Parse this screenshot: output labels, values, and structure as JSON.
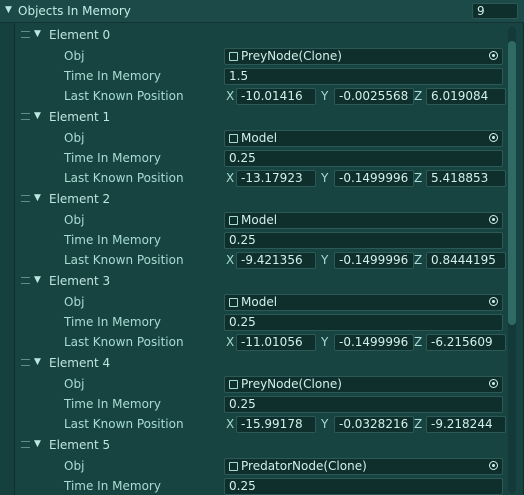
{
  "header": {
    "title": "Objects In Memory",
    "count": "9"
  },
  "labels": {
    "obj": "Obj",
    "time": "Time In Memory",
    "position": "Last Known Position",
    "x": "X",
    "y": "Y",
    "z": "Z"
  },
  "elements": [
    {
      "label": "Element 0",
      "obj": "PreyNode(Clone)",
      "time": "1.5",
      "x": "-10.01416",
      "y": "-0.0025568",
      "z": "6.019084"
    },
    {
      "label": "Element 1",
      "obj": "Model",
      "time": "0.25",
      "x": "-13.17923",
      "y": "-0.1499996",
      "z": "5.418853"
    },
    {
      "label": "Element 2",
      "obj": "Model",
      "time": "0.25",
      "x": "-9.421356",
      "y": "-0.1499996",
      "z": "0.8444195"
    },
    {
      "label": "Element 3",
      "obj": "Model",
      "time": "0.25",
      "x": "-11.01056",
      "y": "-0.1499996",
      "z": "-6.215609"
    },
    {
      "label": "Element 4",
      "obj": "PreyNode(Clone)",
      "time": "0.25",
      "x": "-15.99178",
      "y": "-0.0328216",
      "z": "-9.218244"
    },
    {
      "label": "Element 5",
      "obj": "PredatorNode(Clone)",
      "time": "0.25"
    }
  ],
  "icons": {
    "collapse": "triangle-down-icon",
    "object": "cube-icon",
    "picker": "object-picker-icon",
    "handle": "drag-handle-icon"
  }
}
